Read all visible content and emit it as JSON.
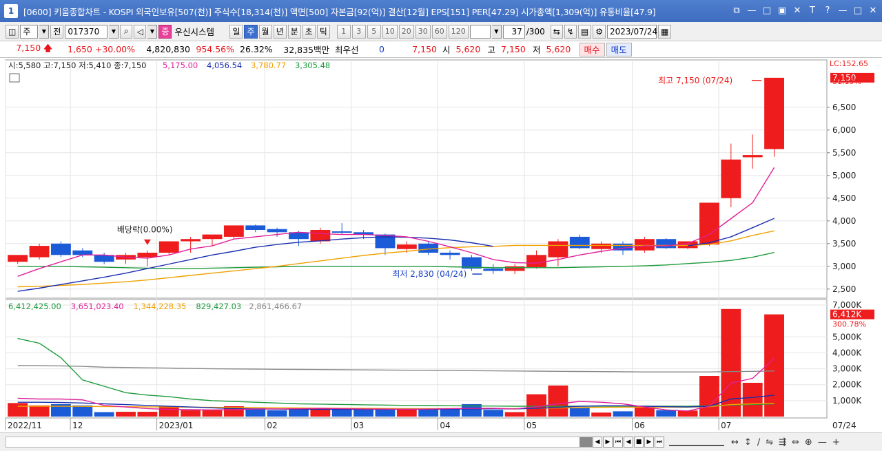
{
  "window": {
    "number": "1",
    "title": "[0600] 키움종합차트 - KOSPI 외국인보유[507(천)] 주식수[18,314(천)] 액면[500] 자본금[92(억)] 결산[12월] EPS[151] PER[47.29] 시가총액[1,309(억)] 유통비율[47.9]",
    "controls": [
      "⧉",
      "—",
      "□",
      "▣",
      "✕",
      "T",
      "?",
      "—",
      "□",
      "✕"
    ]
  },
  "toolbar": {
    "period_select": "주",
    "prev_label": "전",
    "code": "017370",
    "stock_name": "우신시스템",
    "stock_tag": "증",
    "periods": [
      "일",
      "주",
      "월",
      "년",
      "분",
      "초",
      "틱"
    ],
    "active_period": "주",
    "minute_steps": [
      "1",
      "3",
      "5",
      "10",
      "20",
      "30",
      "60",
      "120"
    ],
    "count_value": "37",
    "count_max": "/300",
    "date": "2023/07/24"
  },
  "quote": {
    "price": "7,150",
    "change": "1,650",
    "change_pct": "+30.00%",
    "volume": "4,820,830",
    "vol_ratio": "954.56%",
    "turnover": "26.32%",
    "amount": "32,835백만",
    "type_label": "최우선",
    "bid_qty": "0",
    "best_price": "7,150",
    "open_label": "시",
    "open": "5,620",
    "high_label": "고",
    "high": "7,150",
    "low_label": "저",
    "low": "5,620",
    "buy_label": "매수",
    "sell_label": "매도"
  },
  "colors": {
    "up": "#ee1c1c",
    "down": "#1c5bd8",
    "ma5": "#e0209a",
    "ma10": "#1a2fb0",
    "ma20": "#f0a000",
    "ma60": "#1c9a3c",
    "volma": "#888888"
  },
  "chart_data": {
    "type": "candlestick",
    "price_legend": {
      "ohlc": "시:5,580 고:7,150 저:5,410 종:7,150",
      "ma_values": [
        "5,175.00",
        "4,056.54",
        "3,780.77",
        "3,305.48"
      ]
    },
    "volume_legend": {
      "values": [
        "6,412,425.00",
        "3,651,023.40",
        "1,344,228.35",
        "829,427.03",
        "2,861,466.67"
      ]
    },
    "price_ylim": [
      2300,
      7300
    ],
    "price_ticks": [
      "7,150",
      "6,500",
      "6,000",
      "5,500",
      "5,000",
      "4,500",
      "4,000",
      "3,500",
      "3,000",
      "2,500"
    ],
    "price_tick_values": [
      7150,
      6500,
      6000,
      5500,
      5000,
      4500,
      4000,
      3500,
      3000,
      2500
    ],
    "right_top_label": "LC:152.65",
    "right_top_pct": "31.19%",
    "volume_ylim": [
      0,
      7000000
    ],
    "volume_ticks": [
      "7,000K",
      "6,412K",
      "5,000K",
      "4,000K",
      "3,000K",
      "2,000K",
      "1,000K"
    ],
    "volume_tick_values": [
      7000000,
      6412000,
      5000000,
      4000000,
      3000000,
      2000000,
      1000000
    ],
    "volume_right_pct": "300.78%",
    "x_labels": [
      "2022/11",
      "12",
      "2023/01",
      "02",
      "03",
      "04",
      "05",
      "06",
      "07"
    ],
    "x_label_index": [
      0,
      3,
      7,
      12,
      16,
      20,
      24,
      29,
      33
    ],
    "x_last_label": "07/24",
    "annotations": {
      "high": "최고 7,150 (07/24)",
      "low": "최저 2,830 (04/24)",
      "dividend": "배당락(0.00%)"
    },
    "candles": [
      {
        "o": 3100,
        "h": 3250,
        "l": 3050,
        "c": 3250
      },
      {
        "o": 3200,
        "h": 3500,
        "l": 3150,
        "c": 3450
      },
      {
        "o": 3500,
        "h": 3550,
        "l": 3200,
        "c": 3250
      },
      {
        "o": 3350,
        "h": 3400,
        "l": 3200,
        "c": 3250
      },
      {
        "o": 3250,
        "h": 3300,
        "l": 3050,
        "c": 3100
      },
      {
        "o": 3150,
        "h": 3300,
        "l": 3050,
        "c": 3250
      },
      {
        "o": 3200,
        "h": 3350,
        "l": 3000,
        "c": 3300
      },
      {
        "o": 3300,
        "h": 3550,
        "l": 3250,
        "c": 3550
      },
      {
        "o": 3550,
        "h": 3650,
        "l": 3300,
        "c": 3600
      },
      {
        "o": 3600,
        "h": 3650,
        "l": 3450,
        "c": 3700
      },
      {
        "o": 3650,
        "h": 3900,
        "l": 3600,
        "c": 3900
      },
      {
        "o": 3900,
        "h": 3920,
        "l": 3750,
        "c": 3800
      },
      {
        "o": 3820,
        "h": 3850,
        "l": 3650,
        "c": 3750
      },
      {
        "o": 3750,
        "h": 3780,
        "l": 3450,
        "c": 3600
      },
      {
        "o": 3550,
        "h": 3850,
        "l": 3500,
        "c": 3800
      },
      {
        "o": 3770,
        "h": 3950,
        "l": 3700,
        "c": 3750
      },
      {
        "o": 3750,
        "h": 3800,
        "l": 3600,
        "c": 3700
      },
      {
        "o": 3700,
        "h": 3720,
        "l": 3250,
        "c": 3400
      },
      {
        "o": 3380,
        "h": 3550,
        "l": 3300,
        "c": 3480
      },
      {
        "o": 3500,
        "h": 3550,
        "l": 3250,
        "c": 3300
      },
      {
        "o": 3300,
        "h": 3350,
        "l": 3150,
        "c": 3250
      },
      {
        "o": 3200,
        "h": 3250,
        "l": 2900,
        "c": 2950
      },
      {
        "o": 2950,
        "h": 3050,
        "l": 2830,
        "c": 2900
      },
      {
        "o": 2900,
        "h": 3050,
        "l": 2830,
        "c": 3000
      },
      {
        "o": 2980,
        "h": 3350,
        "l": 2950,
        "c": 3250
      },
      {
        "o": 3200,
        "h": 3600,
        "l": 3000,
        "c": 3550
      },
      {
        "o": 3650,
        "h": 3700,
        "l": 3380,
        "c": 3400
      },
      {
        "o": 3380,
        "h": 3550,
        "l": 3300,
        "c": 3500
      },
      {
        "o": 3500,
        "h": 3550,
        "l": 3250,
        "c": 3350
      },
      {
        "o": 3350,
        "h": 3650,
        "l": 3300,
        "c": 3600
      },
      {
        "o": 3600,
        "h": 3620,
        "l": 3380,
        "c": 3400
      },
      {
        "o": 3400,
        "h": 3550,
        "l": 3380,
        "c": 3550
      },
      {
        "o": 3480,
        "h": 4400,
        "l": 3450,
        "c": 4400
      },
      {
        "o": 4500,
        "h": 5700,
        "l": 4300,
        "c": 5350
      },
      {
        "o": 5400,
        "h": 5900,
        "l": 5150,
        "c": 5450
      },
      {
        "o": 5580,
        "h": 7150,
        "l": 5410,
        "c": 7150
      }
    ],
    "volumes": [
      850000,
      700000,
      780000,
      700000,
      280000,
      300000,
      300000,
      650000,
      400000,
      400000,
      650000,
      520000,
      400000,
      560000,
      540000,
      460000,
      460000,
      430000,
      500000,
      480000,
      520000,
      780000,
      420000,
      280000,
      1400000,
      1950000,
      550000,
      250000,
      330000,
      600000,
      400000,
      380000,
      2550000,
      6750000,
      2120000,
      6412425
    ],
    "ma5": [
      2780,
      2950,
      3100,
      3250,
      3250,
      3200,
      3180,
      3250,
      3380,
      3450,
      3600,
      3650,
      3700,
      3750,
      3720,
      3700,
      3700,
      3680,
      3650,
      3550,
      3430,
      3300,
      3150,
      3080,
      3070,
      3150,
      3250,
      3330,
      3400,
      3450,
      3450,
      3500,
      3700,
      4050,
      4400,
      5175
    ],
    "ma10": [
      2450,
      2520,
      2600,
      2680,
      2760,
      2850,
      2950,
      3050,
      3150,
      3250,
      3330,
      3420,
      3480,
      3530,
      3560,
      3600,
      3630,
      3650,
      3640,
      3620,
      3580,
      3520,
      3440,
      null,
      null,
      null,
      null,
      null,
      null,
      null,
      null,
      3450,
      3520,
      3650,
      3850,
      4056
    ],
    "ma20": [
      2550,
      2560,
      2580,
      2600,
      2630,
      2660,
      2700,
      2750,
      2800,
      2850,
      2900,
      2950,
      3000,
      3060,
      3120,
      3180,
      3240,
      3290,
      3330,
      3380,
      3410,
      3430,
      3440,
      3460,
      3460,
      3460,
      3460,
      3460,
      3460,
      3460,
      3460,
      3460,
      3480,
      3560,
      3680,
      3780
    ],
    "ma60": [
      3000,
      3000,
      3000,
      2990,
      2980,
      2970,
      2960,
      2950,
      2950,
      2960,
      2970,
      2980,
      2990,
      3000,
      3000,
      3000,
      3000,
      3000,
      3000,
      3000,
      2990,
      2980,
      2970,
      2970,
      2970,
      2970,
      2980,
      2990,
      3000,
      3010,
      3030,
      3060,
      3090,
      3130,
      3200,
      3305
    ],
    "vma5": [
      1150000,
      1100000,
      1100000,
      1050000,
      700000,
      600000,
      500000,
      450000,
      430000,
      420000,
      430000,
      480000,
      480000,
      490000,
      520000,
      500000,
      480000,
      470000,
      460000,
      470000,
      500000,
      520000,
      520000,
      480000,
      620000,
      800000,
      950000,
      900000,
      800000,
      600000,
      420000,
      350000,
      650000,
      2100000,
      2400000,
      3651023
    ],
    "vma10": [
      900000,
      900000,
      880000,
      850000,
      800000,
      750000,
      700000,
      650000,
      600000,
      550000,
      500000,
      480000,
      470000,
      460000,
      460000,
      460000,
      460000,
      460000,
      460000,
      460000,
      470000,
      480000,
      490000,
      480000,
      520000,
      580000,
      650000,
      680000,
      680000,
      650000,
      620000,
      600000,
      650000,
      1100000,
      1200000,
      1344228
    ],
    "vma20": [
      650000,
      650000,
      650000,
      640000,
      630000,
      620000,
      610000,
      600000,
      590000,
      580000,
      570000,
      560000,
      550000,
      540000,
      530000,
      520000,
      520000,
      510000,
      500000,
      500000,
      500000,
      500000,
      500000,
      500000,
      520000,
      540000,
      560000,
      580000,
      590000,
      590000,
      590000,
      590000,
      620000,
      750000,
      800000,
      829427
    ],
    "vma60": [
      4900000,
      4600000,
      3700000,
      2300000,
      1900000,
      1500000,
      1350000,
      1250000,
      1100000,
      1000000,
      950000,
      900000,
      850000,
      800000,
      780000,
      760000,
      740000,
      720000,
      700000,
      690000,
      680000,
      670000,
      660000,
      650000,
      650000,
      650000,
      650000,
      650000,
      650000,
      650000,
      650000,
      650000,
      680000,
      720000,
      760000,
      800000
    ],
    "vma120": [
      3200000,
      3200000,
      3180000,
      3150000,
      3100000,
      3080000,
      3060000,
      3040000,
      3020000,
      3000000,
      2990000,
      2980000,
      2970000,
      2960000,
      2950000,
      2940000,
      2930000,
      2920000,
      2910000,
      2900000,
      2890000,
      2880000,
      2870000,
      2860000,
      2850000,
      2840000,
      2830000,
      2820000,
      2810000,
      2800000,
      2800000,
      2800000,
      2800000,
      2820000,
      2840000,
      2861466
    ]
  },
  "bottom_icons": [
    "◀",
    "▶",
    "⏮",
    "◀",
    "■",
    "▶",
    "⏭"
  ],
  "bottom_tools": [
    "↔",
    "↕",
    "∕",
    "⇋",
    "⇶",
    "⇔",
    "⊕",
    "—",
    "+"
  ]
}
